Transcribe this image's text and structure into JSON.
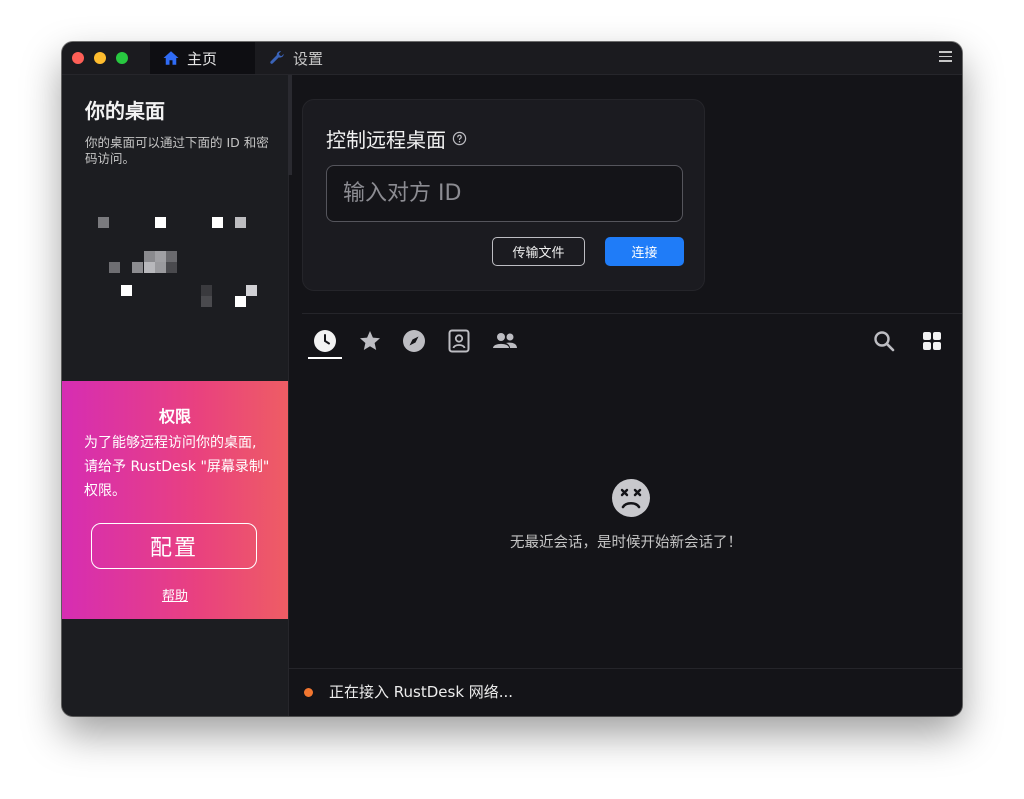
{
  "titlebar": {
    "tabs": [
      {
        "label": "主页",
        "icon": "home-icon",
        "active": true
      },
      {
        "label": "设置",
        "icon": "wrench-icon",
        "active": false
      }
    ],
    "menu_icon": "hamburger-menu-icon"
  },
  "left": {
    "title": "你的桌面",
    "description": "你的桌面可以通过下面的 ID 和密码访问。",
    "permission": {
      "title": "权限",
      "text": "为了能够远程访问你的桌面, 请给予 RustDesk \"屏幕录制\" 权限。",
      "button": "配置",
      "help": "帮助"
    }
  },
  "connect": {
    "title": "控制远程桌面",
    "id_placeholder": "输入对方 ID",
    "id_value": "",
    "transfer_button": "传输文件",
    "connect_button": "连接"
  },
  "peers": {
    "tabs": [
      "recent-clock-icon",
      "favorites-star-icon",
      "discover-compass-icon",
      "address-book-icon",
      "group-icon"
    ],
    "active_tab": "recent-clock-icon",
    "empty_text": "无最近会话，是时候开始新会话了！"
  },
  "status": {
    "text": "正在接入 RustDesk 网络...",
    "dot_color": "#f2762f"
  },
  "colors": {
    "accent": "#1f7cf8",
    "window_bg": "#141418",
    "panel_bg": "#1c1d21",
    "permission_gradient": [
      "#d62db3",
      "#ee5d64"
    ]
  }
}
